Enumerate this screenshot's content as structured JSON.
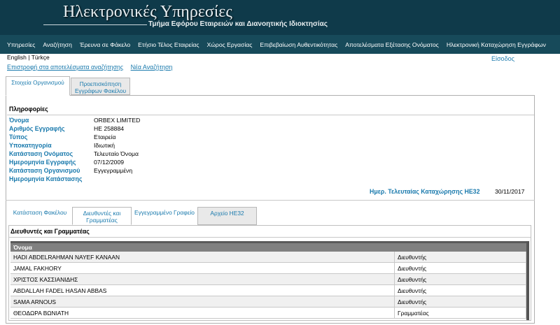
{
  "header": {
    "site_title": "Ηλεκτρονικές Υπηρεσίες",
    "department": "Τμήμα Εφόρου Εταιρειών και Διανοητικής Ιδιοκτησίας"
  },
  "nav": [
    "Υπηρεσίες",
    "Αναζήτηση",
    "Έρευνα σε Φάκελο",
    "Ετήσιο Τέλος Εταιρείας",
    "Χώρος Εργασίας",
    "Επιβεβαίωση Αυθεντικότητας",
    "Αποτελέσματα Εξέτασης Ονόματος",
    "Ηλεκτρονική Καταχώρηση Εγγράφων"
  ],
  "lang": {
    "english": "English",
    "separator": "|",
    "turkish": "Türkçe"
  },
  "login": "Είσοδος",
  "links": {
    "back": "Επιστροφή στα αποτελέσματα αναζήτησης",
    "new_search": "Νέα Αναζήτηση"
  },
  "tabs": [
    {
      "label": "Στοιχεία Οργανισμού"
    },
    {
      "label": "Προεπισκόπηση Εγγράφων Φακέλου"
    }
  ],
  "info": {
    "title": "Πληροφορίες",
    "fields": [
      {
        "label": "Όνομα",
        "value": "ORBEX LIMITED"
      },
      {
        "label": "Αριθμός Εγγραφής",
        "value": "HE 258884"
      },
      {
        "label": "Τύπος",
        "value": "Εταιρεία"
      },
      {
        "label": "Υποκατηγορία",
        "value": "Ιδιωτική"
      },
      {
        "label": "Κατάσταση Ονόματος",
        "value": "Τελευταίο Όνομα"
      },
      {
        "label": "Ημερομηνία Εγγραφής",
        "value": "07/12/2009"
      },
      {
        "label": "Κατάσταση Οργανισμού",
        "value": "Εγγεγραμμένη"
      },
      {
        "label": "Ημερομηνία Κατάστασης",
        "value": ""
      }
    ],
    "last_he32_label": "Ημερ. Τελευταίας Καταχώρησης HE32",
    "last_he32_value": "30/11/2017"
  },
  "subtabs": [
    {
      "label": "Κατάσταση Φακέλου"
    },
    {
      "label": "Διευθυντές και Γραμματέας"
    },
    {
      "label": "Εγγεγραμμένο Γραφείο"
    },
    {
      "label": "Αρχείο HE32"
    }
  ],
  "directors": {
    "title": "Διευθυντές και Γραμματέας",
    "column": "Όνομα",
    "rows": [
      {
        "name": "HADI ABDELRAHMAN NAYEF KANAAN",
        "role": "Διευθυντής"
      },
      {
        "name": "JAMAL FAKHORY",
        "role": "Διευθυντής"
      },
      {
        "name": "ΧΡΙΣΤΟΣ ΚΑΣΣΙΑΝΙΔΗΣ",
        "role": "Διευθυντής"
      },
      {
        "name": "ABDALLAH FADEL HASAN ABBAS",
        "role": "Διευθυντής"
      },
      {
        "name": "SAMA ARNOUS",
        "role": "Διευθυντής"
      },
      {
        "name": "ΘΕΟΔΩΡΑ ΒΩΝΙΑΤΗ",
        "role": "Γραμματέας"
      }
    ]
  }
}
